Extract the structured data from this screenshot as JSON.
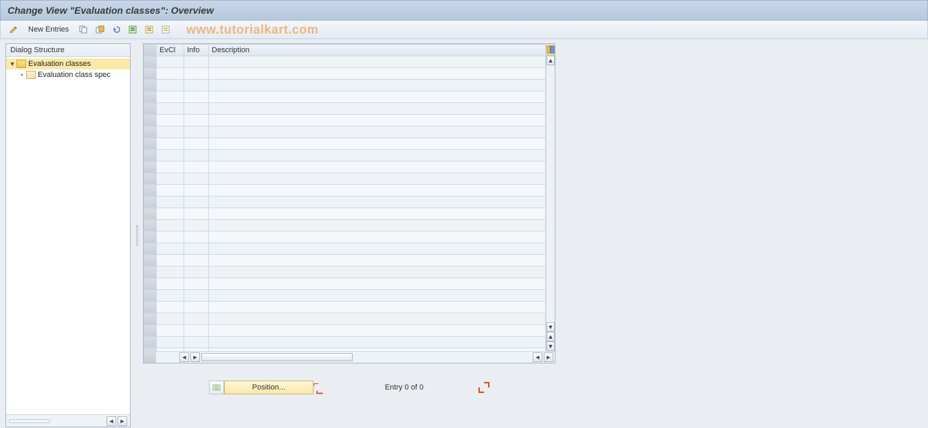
{
  "title": "Change View \"Evaluation classes\": Overview",
  "toolbar": {
    "new_entries_label": "New Entries",
    "icons": {
      "toggle": "toggle-display-change-icon",
      "copy": "copy-icon",
      "save": "save-icon",
      "undo": "undo-icon",
      "select_all": "select-all-icon",
      "select_block": "select-block-icon",
      "deselect_all": "deselect-all-icon"
    }
  },
  "watermark": "www.tutorialkart.com",
  "sidebar": {
    "header": "Dialog Structure",
    "nodes": [
      {
        "label": "Evaluation classes",
        "expanded": true,
        "selected": true,
        "icon": "folder-open"
      },
      {
        "label": "Evaluation class spec",
        "expanded": false,
        "selected": false,
        "icon": "folder-closed",
        "indent": 1
      }
    ]
  },
  "grid": {
    "columns": {
      "evcl": "EvCl",
      "info": "Info",
      "description": "Description"
    },
    "row_count": 26,
    "rows": []
  },
  "position": {
    "button_label": "Position...",
    "entry_label": "Entry 0 of 0"
  },
  "colors": {
    "accent_yellow": "#f7e9a8",
    "header_blue": "#b5c9de",
    "orange_watermark": "#f0b27a"
  }
}
